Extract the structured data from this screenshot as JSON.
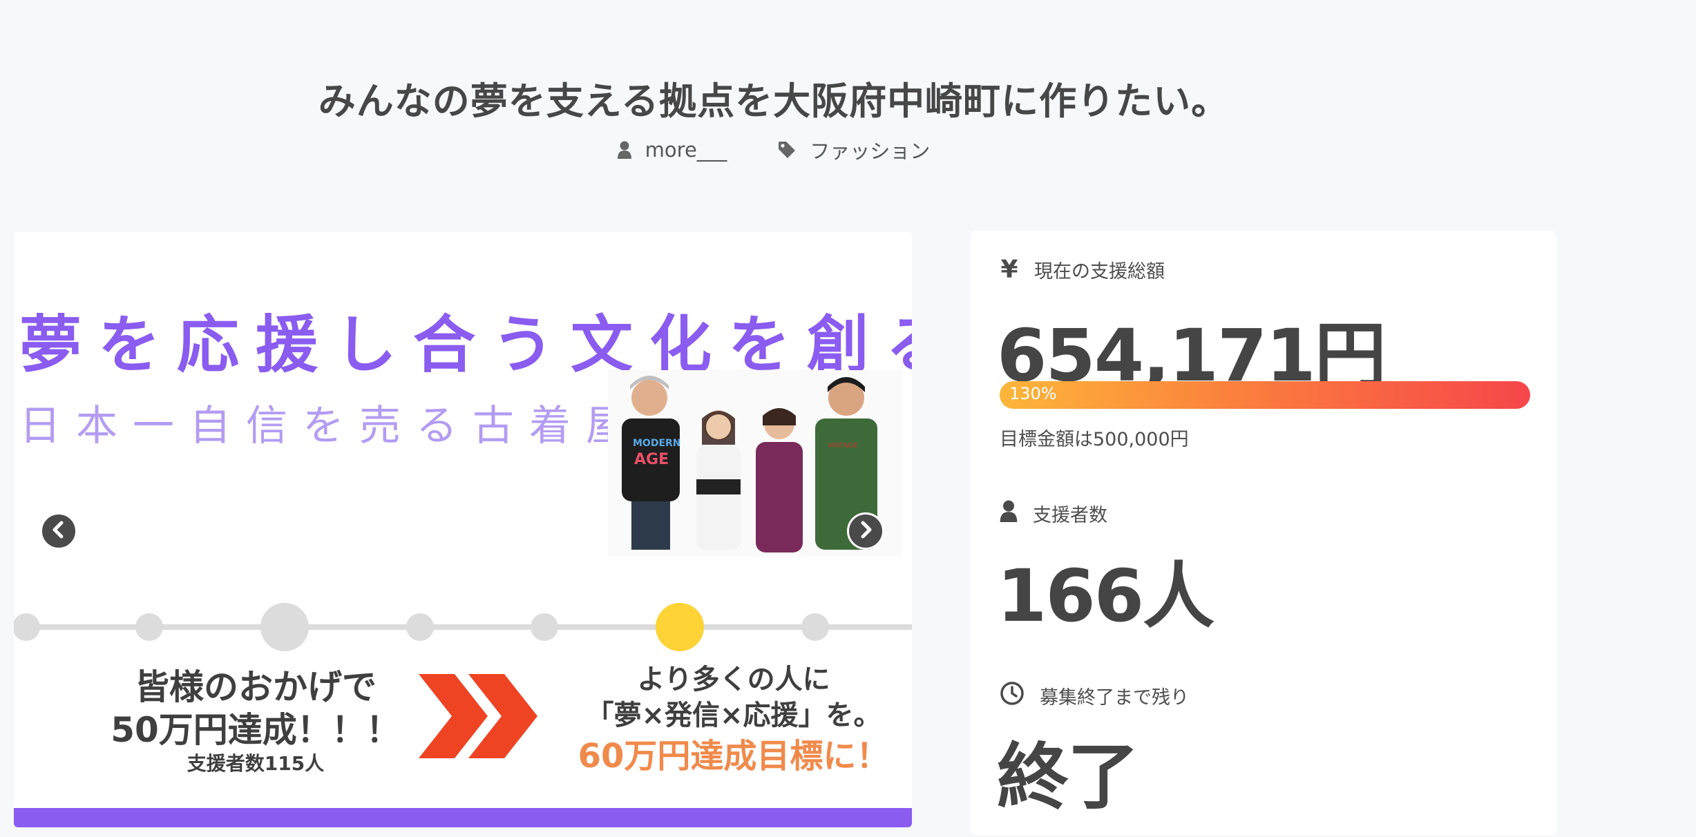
{
  "project": {
    "title": "みんなの夢を支える拠点を大阪府中崎町に作りたい。",
    "owner": "more___",
    "category": "ファッション"
  },
  "slider": {
    "headline": "夢を応援し合う文化を創る",
    "subheadline": "日本一自信を売る古着屋に",
    "left_message_line1": "皆様のおかげで",
    "left_message_line2": "50万円達成！！！",
    "left_message_line3": "支援者数115人",
    "right_message_line1": "より多くの人に",
    "right_message_line2": "「夢×発信×応援」を。",
    "right_message_line3": "60万円達成目標に！",
    "timeline_active_step": 6,
    "timeline_steps": 7
  },
  "stats": {
    "amount_label": "現在の支援総額",
    "amount_value": "654,171円",
    "progress_label": "130%",
    "progress_fraction": 1.0,
    "goal_text": "目標金額は500,000円",
    "supporters_label": "支援者数",
    "supporters_value": "166人",
    "remaining_label": "募集終了まで残り",
    "remaining_value": "終了"
  },
  "colors": {
    "accent_purple": "#8a5cf0",
    "progress_start": "#fcb63a",
    "progress_end": "#f6464a",
    "timeline_active": "#fdd335",
    "orange_text": "#f08a4b",
    "chevron_red": "#ef4423"
  },
  "icons": {
    "owner": "user-icon",
    "category": "tag-icon",
    "amount": "yen-icon",
    "supporters": "user-icon",
    "remaining": "clock-icon",
    "prev": "chevron-left-icon",
    "next": "chevron-right-icon"
  }
}
